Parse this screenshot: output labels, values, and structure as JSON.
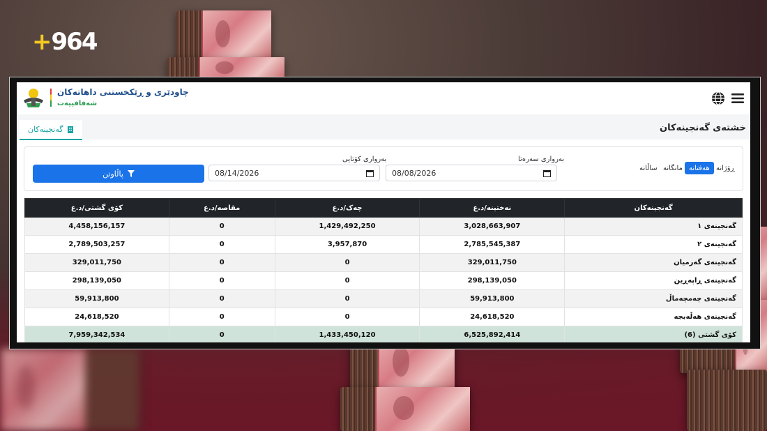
{
  "brand": {
    "logo_text": "964",
    "logo_plus": "+"
  },
  "app": {
    "title": "چاودێری و ڕێکخستنی داهاتەکان",
    "subtitle": "شەفافییەت"
  },
  "tab": {
    "label": "گەنجینەکان"
  },
  "page_title": "خشتەی گەنجینەکان",
  "filter": {
    "periods": [
      "ڕۆژانە",
      "هەفتانە",
      "مانگانە",
      "ساڵانە"
    ],
    "active_period": "هەفتانە",
    "start_label": "بەرواری سەرەتا",
    "start_value": "08/08/2026",
    "end_label": "بەرواری کۆتایی",
    "end_value": "08/14/2026",
    "button_label": "پاڵاوتن"
  },
  "table": {
    "headers": [
      "گەنجینەکان",
      "نەختینە/د.ع",
      "چەک/د.ع",
      "مقاصە/د.ع",
      "کۆی گشتی/د.ع"
    ],
    "rows": [
      [
        "گەنجینەی ١",
        "3,028,663,907",
        "1,429,492,250",
        "0",
        "4,458,156,157"
      ],
      [
        "گەنجینەی ٢",
        "2,785,545,387",
        "3,957,870",
        "0",
        "2,789,503,257"
      ],
      [
        "گەنجینەی گەرمیان",
        "329,011,750",
        "0",
        "0",
        "329,011,750"
      ],
      [
        "گەنجینەی ڕاپەڕین",
        "298,139,050",
        "0",
        "0",
        "298,139,050"
      ],
      [
        "گەنجینەی چەمچەماڵ",
        "59,913,800",
        "0",
        "0",
        "59,913,800"
      ],
      [
        "گەنجینەی هەڵەبجە",
        "24,618,520",
        "0",
        "0",
        "24,618,520"
      ]
    ],
    "total": [
      "کۆی گشتی (6)",
      "6,525,892,414",
      "1,433,450,120",
      "0",
      "7,959,342,534"
    ]
  },
  "colors": {
    "primary": "#1a73e8",
    "accent": "#16a3a3",
    "header_dark": "#212529",
    "total_row": "#cfe3da",
    "logo_yellow": "#f3c921"
  }
}
